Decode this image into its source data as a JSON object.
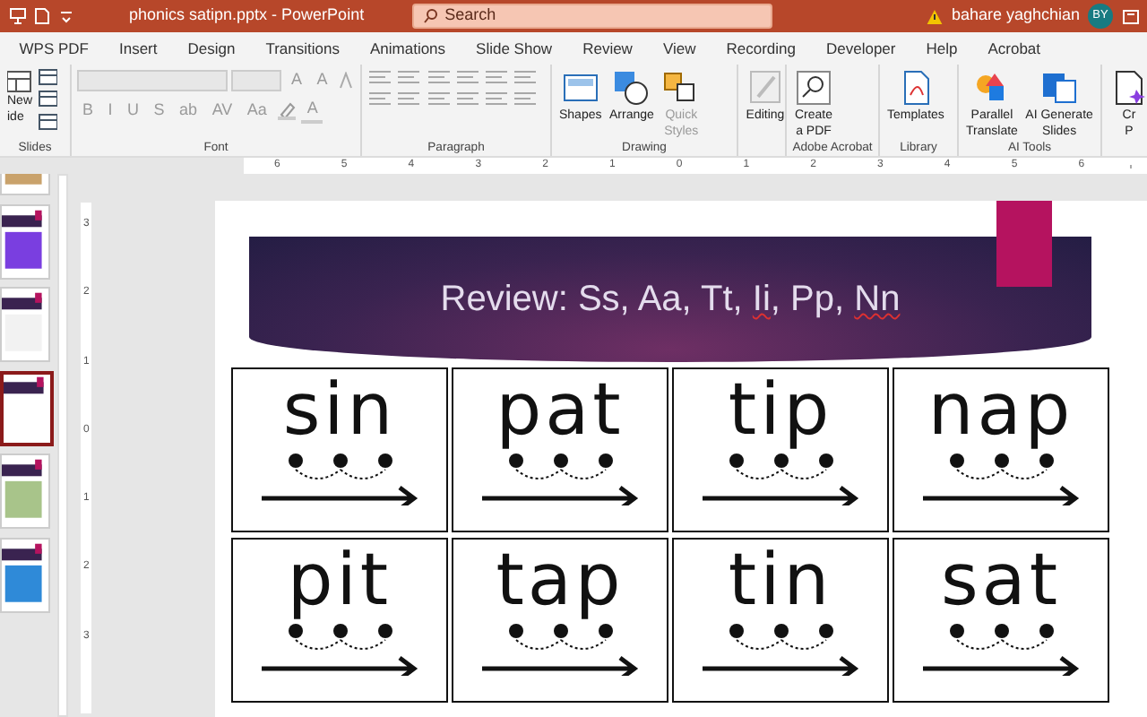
{
  "window": {
    "title": "phonics satipn.pptx  -  PowerPoint"
  },
  "search": {
    "placeholder": "Search"
  },
  "account": {
    "name": "bahare yaghchian",
    "initials": "BY"
  },
  "tabs": [
    "WPS PDF",
    "Insert",
    "Design",
    "Transitions",
    "Animations",
    "Slide Show",
    "Review",
    "View",
    "Recording",
    "Developer",
    "Help",
    "Acrobat"
  ],
  "ribbon": [
    {
      "kind": "slides",
      "label": "Slides",
      "buttons": [
        {
          "lines": [
            "New",
            "ide"
          ]
        }
      ]
    },
    {
      "kind": "font",
      "label": "Font",
      "disabled": true,
      "glyphs": [
        "B",
        "I",
        "U",
        "S",
        "ab",
        "AV",
        "Aa"
      ],
      "size_glyphs": [
        "A",
        "A"
      ],
      "color_glyph": "A"
    },
    {
      "kind": "paragraph",
      "label": "Paragraph",
      "disabled": true
    },
    {
      "kind": "large",
      "label": "Drawing",
      "buttons": [
        {
          "lines": [
            "Shapes"
          ],
          "disabled": false
        },
        {
          "lines": [
            "Arrange"
          ],
          "disabled": false
        },
        {
          "lines": [
            "Quick",
            "Styles"
          ],
          "disabled": true
        }
      ]
    },
    {
      "kind": "large",
      "buttons": [
        {
          "lines": [
            "Editing"
          ]
        }
      ]
    },
    {
      "kind": "large",
      "label": "Adobe Acrobat",
      "buttons": [
        {
          "lines": [
            "Create",
            "a PDF"
          ]
        }
      ]
    },
    {
      "kind": "large",
      "label": "Library",
      "buttons": [
        {
          "lines": [
            "Templates"
          ]
        }
      ]
    },
    {
      "kind": "large",
      "label": "AI Tools",
      "buttons": [
        {
          "lines": [
            "Parallel",
            "Translate"
          ]
        },
        {
          "lines": [
            "AI Generate",
            "Slides"
          ]
        }
      ]
    },
    {
      "kind": "large",
      "buttons": [
        {
          "lines": [
            "Cr",
            "P"
          ]
        }
      ]
    }
  ],
  "ruler": {
    "horizontal": [
      "6",
      "5",
      "4",
      "3",
      "2",
      "1",
      "0",
      "1",
      "2",
      "3",
      "4",
      "5",
      "6"
    ],
    "vertical": [
      "3",
      "2",
      "1",
      "0",
      "1",
      "2",
      "3"
    ]
  },
  "thumbnails": [
    {
      "selected": false
    },
    {
      "selected": false
    },
    {
      "selected": false
    },
    {
      "selected": true
    },
    {
      "selected": false
    },
    {
      "selected": false
    }
  ],
  "slide": {
    "title": [
      {
        "text": "Review: Ss, Aa, Tt, ",
        "misspelled": false
      },
      {
        "text": "Ii",
        "misspelled": true
      },
      {
        "text": ", Pp, ",
        "misspelled": false
      },
      {
        "text": "Nn",
        "misspelled": true
      }
    ],
    "cards": [
      {
        "word": "sin"
      },
      {
        "word": "pat"
      },
      {
        "word": "tip"
      },
      {
        "word": "nap"
      },
      {
        "word": "pit"
      },
      {
        "word": "tap"
      },
      {
        "word": "tin"
      },
      {
        "word": "sat"
      }
    ]
  }
}
